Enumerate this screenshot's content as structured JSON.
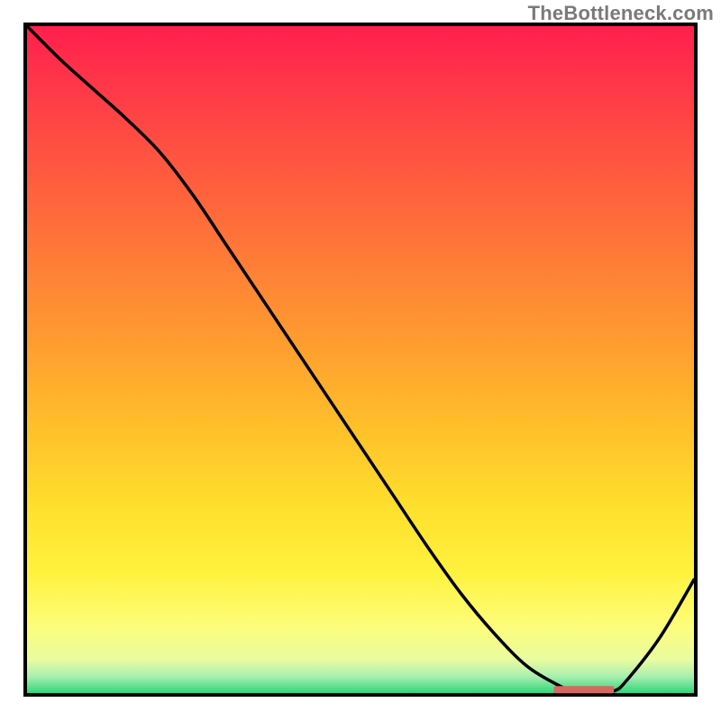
{
  "watermark": "TheBottleneck.com",
  "chart_data": {
    "type": "line",
    "title": "",
    "xlabel": "",
    "ylabel": "",
    "xlim": [
      0,
      100
    ],
    "ylim": [
      0,
      100
    ],
    "grid": false,
    "legend": false,
    "series": [
      {
        "name": "curve",
        "x": [
          0,
          5,
          10,
          15,
          20,
          25,
          30,
          35,
          40,
          45,
          50,
          55,
          60,
          65,
          70,
          75,
          80,
          82,
          85,
          88,
          90,
          95,
          100
        ],
        "y": [
          100,
          95,
          90.5,
          86,
          81,
          74.5,
          67,
          59.5,
          52,
          44.5,
          37,
          29.5,
          22,
          15,
          9,
          4,
          1,
          0.3,
          0.1,
          0.3,
          2,
          8.5,
          17
        ]
      }
    ],
    "marker": {
      "name": "flat-band-marker",
      "x_start": 79,
      "x_end": 88,
      "y": 0.5,
      "color": "#d46a5f"
    },
    "background": {
      "type": "vertical-gradient",
      "inner_green_band": true,
      "stops": [
        {
          "offset": 0.0,
          "color": "#ff1f4e"
        },
        {
          "offset": 0.1,
          "color": "#ff3a47"
        },
        {
          "offset": 0.22,
          "color": "#ff5a3f"
        },
        {
          "offset": 0.35,
          "color": "#ff7c37"
        },
        {
          "offset": 0.48,
          "color": "#ff9e2f"
        },
        {
          "offset": 0.6,
          "color": "#ffbf2a"
        },
        {
          "offset": 0.72,
          "color": "#ffdf2d"
        },
        {
          "offset": 0.82,
          "color": "#fff23e"
        },
        {
          "offset": 0.9,
          "color": "#fdfd7a"
        },
        {
          "offset": 0.95,
          "color": "#e8fca0"
        },
        {
          "offset": 0.975,
          "color": "#a9efb0"
        },
        {
          "offset": 1.0,
          "color": "#2fd67a"
        }
      ]
    }
  },
  "plot_frame": {
    "outer_left": 28,
    "outer_top": 27,
    "outer_size": 744,
    "stroke_width": 4
  }
}
